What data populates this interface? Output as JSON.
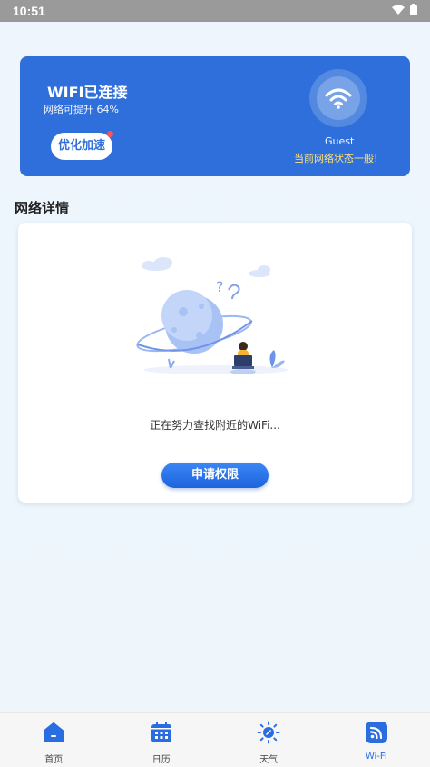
{
  "status_bar": {
    "time": "10:51"
  },
  "hero": {
    "title": "WIFI已连接",
    "subtitle": "网络可提升 64%",
    "boost_label": "优化加速",
    "ssid": "Guest",
    "state_text": "当前网络状态一般!"
  },
  "section": {
    "title": "网络详情"
  },
  "detail": {
    "searching_text": "正在努力查找附近的WiFi...",
    "apply_label": "申请权限"
  },
  "nav": {
    "items": [
      {
        "label": "首页",
        "icon": "home-icon"
      },
      {
        "label": "日历",
        "icon": "calendar-icon"
      },
      {
        "label": "天气",
        "icon": "weather-icon"
      },
      {
        "label": "Wi-Fi",
        "icon": "wifi-icon"
      }
    ],
    "active_index": 3
  },
  "colors": {
    "primary": "#2f6fdb",
    "accent_yellow": "#ffe27a",
    "badge_red": "#ff5353"
  }
}
